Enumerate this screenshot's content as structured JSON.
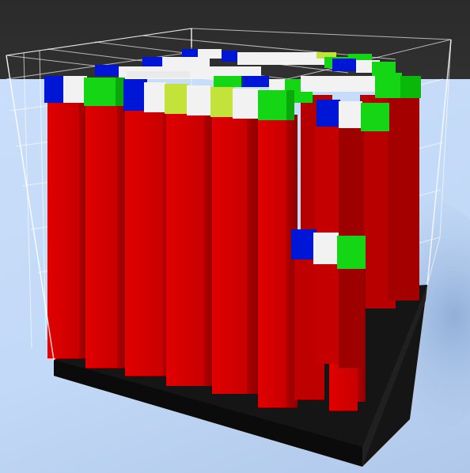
{
  "scene": {
    "type": "voxel-structure-3d-view",
    "colors": {
      "background_top": "#2b2b2b",
      "floor": "#c6dcf8",
      "platform": "#111111",
      "column": "#d80000",
      "column_shadow": "#a80000",
      "grid_lines": "#ffffff",
      "accent_blue": "#0016d6",
      "accent_white": "#f2f2f2",
      "accent_green": "#14d614",
      "accent_yellow": "#c4e33a"
    },
    "columns_count": 16,
    "caps": [
      {
        "name": "front-left-cap",
        "blocks": [
          "blue",
          "white",
          "green"
        ]
      },
      {
        "name": "front-center-cap",
        "blocks": [
          "blue",
          "white",
          "yellow",
          "white",
          "yellow",
          "white",
          "green"
        ]
      },
      {
        "name": "right-upper-cap",
        "blocks": [
          "blue",
          "white",
          "green"
        ]
      },
      {
        "name": "right-lower-cap",
        "blocks": [
          "blue",
          "white",
          "green"
        ]
      },
      {
        "name": "back-cap-1",
        "blocks": [
          "blue",
          "white",
          "white",
          "white",
          "green"
        ]
      },
      {
        "name": "back-cap-2",
        "blocks": [
          "blue",
          "white",
          "white",
          "yellow",
          "white",
          "green"
        ]
      }
    ]
  }
}
